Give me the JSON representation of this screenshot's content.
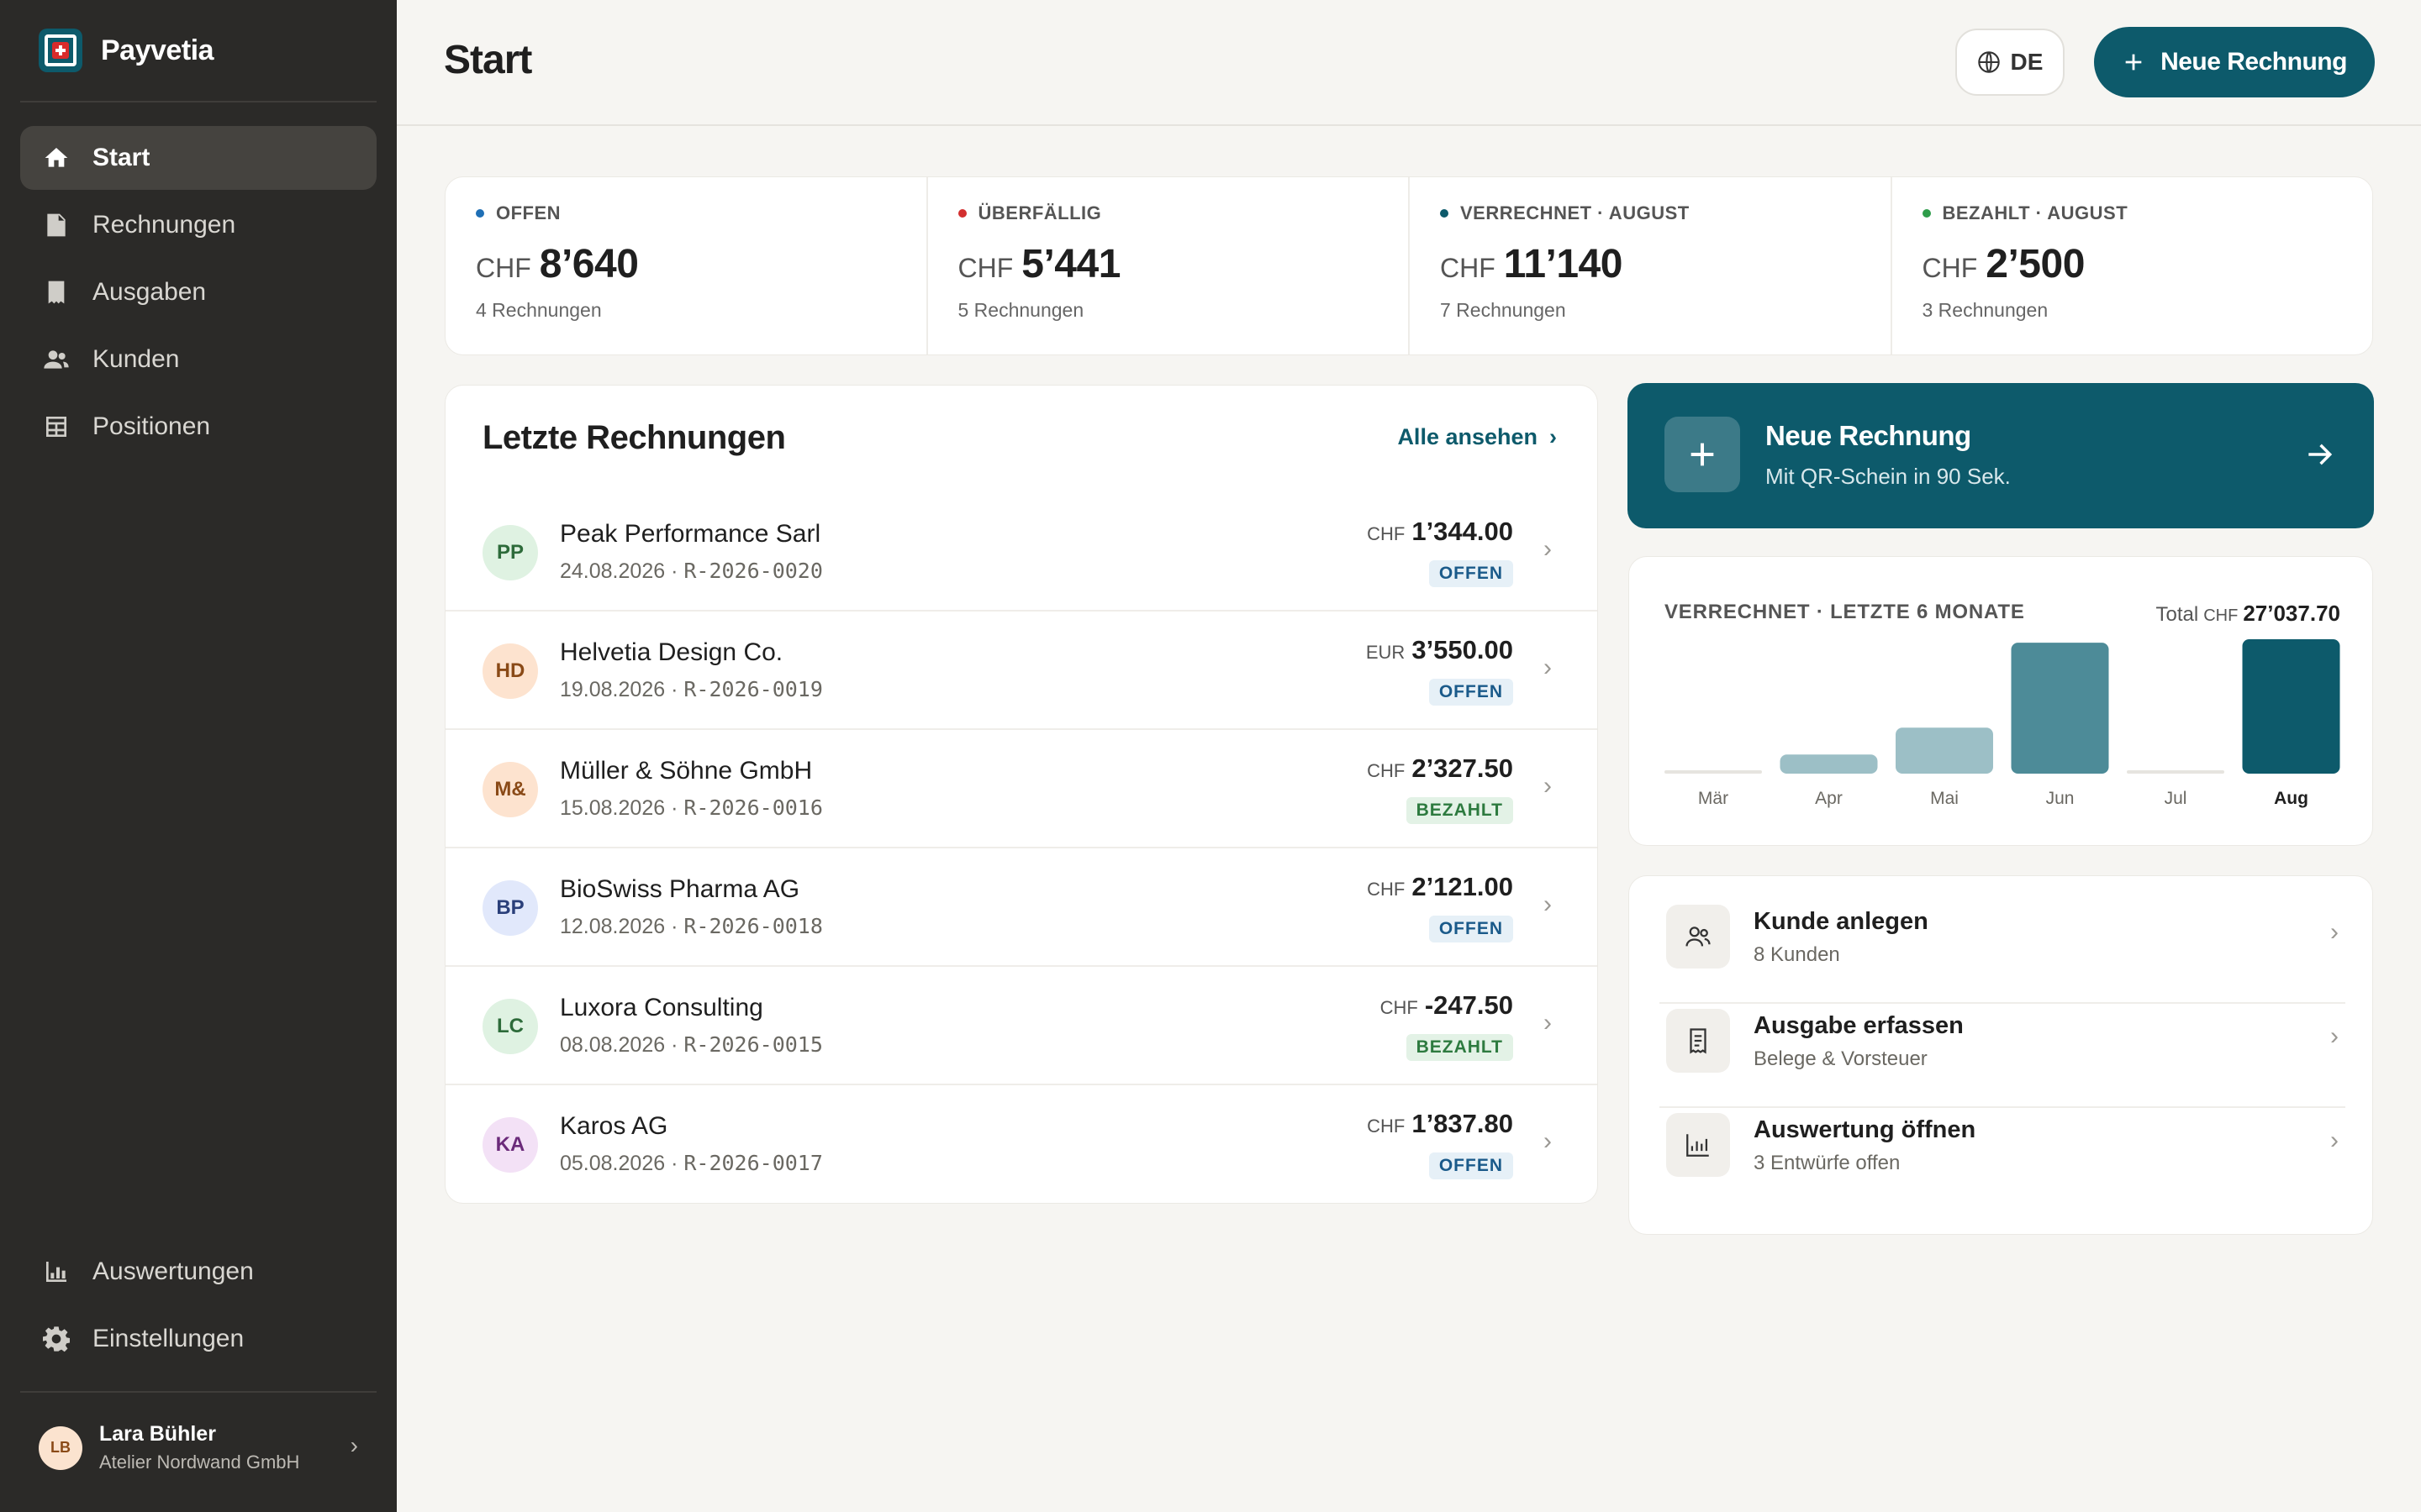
{
  "app": {
    "name": "Payvetia"
  },
  "sidebar": {
    "items": [
      {
        "label": "Start",
        "icon": "home-icon",
        "active": true
      },
      {
        "label": "Rechnungen",
        "icon": "document-icon"
      },
      {
        "label": "Ausgaben",
        "icon": "receipt-icon"
      },
      {
        "label": "Kunden",
        "icon": "people-icon"
      },
      {
        "label": "Positionen",
        "icon": "table-icon"
      }
    ],
    "bottom_items": [
      {
        "label": "Auswertungen",
        "icon": "bar-chart-icon"
      },
      {
        "label": "Einstellungen",
        "icon": "gear-icon"
      }
    ],
    "user": {
      "initials": "LB",
      "name": "Lara Bühler",
      "org": "Atelier Nordwand GmbH"
    }
  },
  "header": {
    "title": "Start",
    "lang_label": "DE",
    "new_invoice_label": "Neue Rechnung"
  },
  "stats": [
    {
      "label": "OFFEN",
      "dot_color": "#1f6fb5",
      "currency": "CHF",
      "value": "8’640",
      "sub": "4 Rechnungen"
    },
    {
      "label": "ÜBERFÄLLIG",
      "dot_color": "#d32f2f",
      "currency": "CHF",
      "value": "5’441",
      "sub": "5 Rechnungen"
    },
    {
      "label": "VERRECHNET · AUGUST",
      "dot_color": "#0d5a6b",
      "currency": "CHF",
      "value": "11’140",
      "sub": "7 Rechnungen"
    },
    {
      "label": "BEZAHLT · AUGUST",
      "dot_color": "#2e9d4a",
      "currency": "CHF",
      "value": "2’500",
      "sub": "3 Rechnungen"
    }
  ],
  "invoices": {
    "title": "Letzte Rechnungen",
    "view_all_label": "Alle ansehen",
    "rows": [
      {
        "initials": "PP",
        "av_bg": "#dff2e2",
        "av_fg": "#2d6b3a",
        "name": "Peak Performance Sarl",
        "date": "24.08.2026",
        "number": "R-2026-0020",
        "currency": "CHF",
        "amount": "1’344.00",
        "status": "OFFEN",
        "status_kind": "offen"
      },
      {
        "initials": "HD",
        "av_bg": "#fde3cf",
        "av_fg": "#8a4a17",
        "name": "Helvetia Design Co.",
        "date": "19.08.2026",
        "number": "R-2026-0019",
        "currency": "EUR",
        "amount": "3’550.00",
        "status": "OFFEN",
        "status_kind": "offen"
      },
      {
        "initials": "M&",
        "av_bg": "#fde3cf",
        "av_fg": "#8a4a17",
        "name": "Müller & Söhne GmbH",
        "date": "15.08.2026",
        "number": "R-2026-0016",
        "currency": "CHF",
        "amount": "2’327.50",
        "status": "BEZAHLT",
        "status_kind": "bezahlt"
      },
      {
        "initials": "BP",
        "av_bg": "#e1e8fb",
        "av_fg": "#2a3f7a",
        "name": "BioSwiss Pharma AG",
        "date": "12.08.2026",
        "number": "R-2026-0018",
        "currency": "CHF",
        "amount": "2’121.00",
        "status": "OFFEN",
        "status_kind": "offen"
      },
      {
        "initials": "LC",
        "av_bg": "#dff2e2",
        "av_fg": "#2d6b3a",
        "name": "Luxora Consulting",
        "date": "08.08.2026",
        "number": "R-2026-0015",
        "currency": "CHF",
        "amount": "-247.50",
        "status": "BEZAHLT",
        "status_kind": "bezahlt"
      },
      {
        "initials": "KA",
        "av_bg": "#f3e1f6",
        "av_fg": "#6b2a7a",
        "name": "Karos AG",
        "date": "05.08.2026",
        "number": "R-2026-0017",
        "currency": "CHF",
        "amount": "1’837.80",
        "status": "OFFEN",
        "status_kind": "offen"
      }
    ]
  },
  "promo": {
    "title": "Neue Rechnung",
    "subtitle": "Mit QR-Schein in 90 Sek."
  },
  "chart_card": {
    "title": "VERRECHNET · LETZTE 6 MONATE",
    "total_prefix": "Total",
    "total_currency": "CHF",
    "total_value": "27’037.70"
  },
  "chart_data": {
    "type": "bar",
    "title": "VERRECHNET · LETZTE 6 MONATE",
    "categories": [
      "Mär",
      "Apr",
      "Mai",
      "Jun",
      "Jul",
      "Aug"
    ],
    "values": [
      0,
      2200,
      5300,
      15100,
      0,
      15500
    ],
    "highlight": "Aug",
    "colors": [
      "#9cbfc6",
      "#9cbfc6",
      "#9cbfc6",
      "#4d8b98",
      "#9cbfc6",
      "#0d5a6b"
    ]
  },
  "actions": [
    {
      "title": "Kunde anlegen",
      "sub": "8 Kunden",
      "icon": "people-icon"
    },
    {
      "title": "Ausgabe erfassen",
      "sub": "Belege & Vorsteuer",
      "icon": "receipt-icon"
    },
    {
      "title": "Auswertung öffnen",
      "sub": "3 Entwürfe offen",
      "icon": "bar-chart-icon"
    }
  ]
}
